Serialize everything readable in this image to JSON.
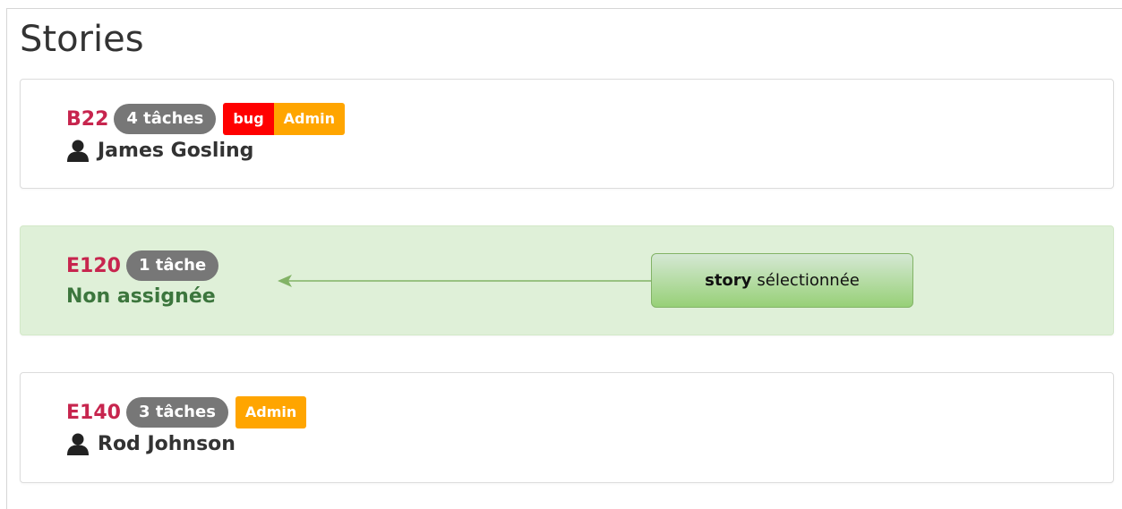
{
  "page": {
    "title": "Stories"
  },
  "stories": [
    {
      "id": "B22",
      "tasks": "4 tâches",
      "labels": [
        "bug",
        "Admin"
      ],
      "assignee": "James Gosling",
      "assignee_icon": "user-icon"
    },
    {
      "id": "E120",
      "tasks": "1 tâche",
      "labels": [],
      "assignee": "Non assignée",
      "selected": true
    },
    {
      "id": "E140",
      "tasks": "3 tâches",
      "labels": [
        "Admin"
      ],
      "assignee": "Rod Johnson",
      "assignee_icon": "user-icon"
    }
  ],
  "callout": {
    "bold": "story",
    "text": "sélectionnée"
  },
  "colors": {
    "story_id": "#c7254e",
    "task_badge": "#777777",
    "label_bug": "#ff0000",
    "label_admin": "#ffa500",
    "selected_bg": "#dff0d8",
    "unassigned_text": "#3c763d",
    "callout_border": "#82b366",
    "arrow": "#82b366"
  }
}
